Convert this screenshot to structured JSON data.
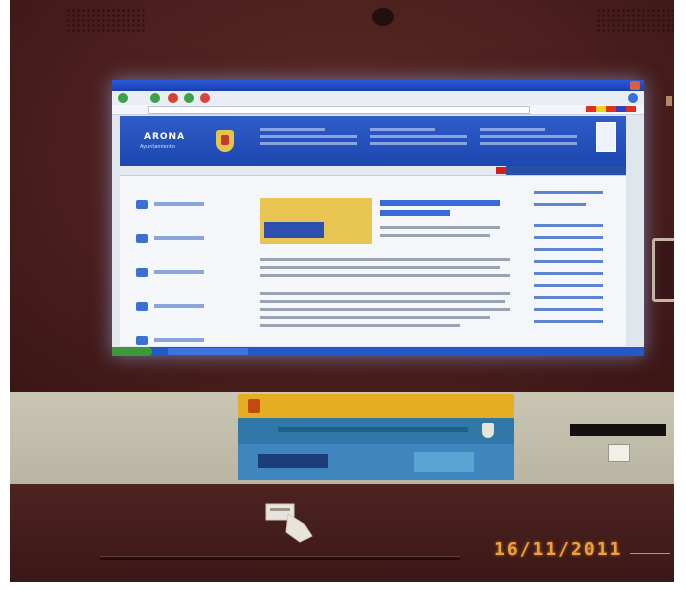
{
  "kiosk": {
    "date_stamp": "16/11/2011"
  },
  "screen": {
    "site": "ARONA",
    "site_sub": "Ayuntamiento"
  },
  "colors": {
    "frame": "#4a1f1d",
    "banner_blue": "#2f5cc8",
    "sign_yellow": "#e7ad22",
    "sign_blue": "#3e86bd",
    "date_orange": "#f0a03a"
  },
  "icons": [
    "card-insert-icon",
    "coat-of-arms-icon",
    "shield-logo-icon"
  ]
}
